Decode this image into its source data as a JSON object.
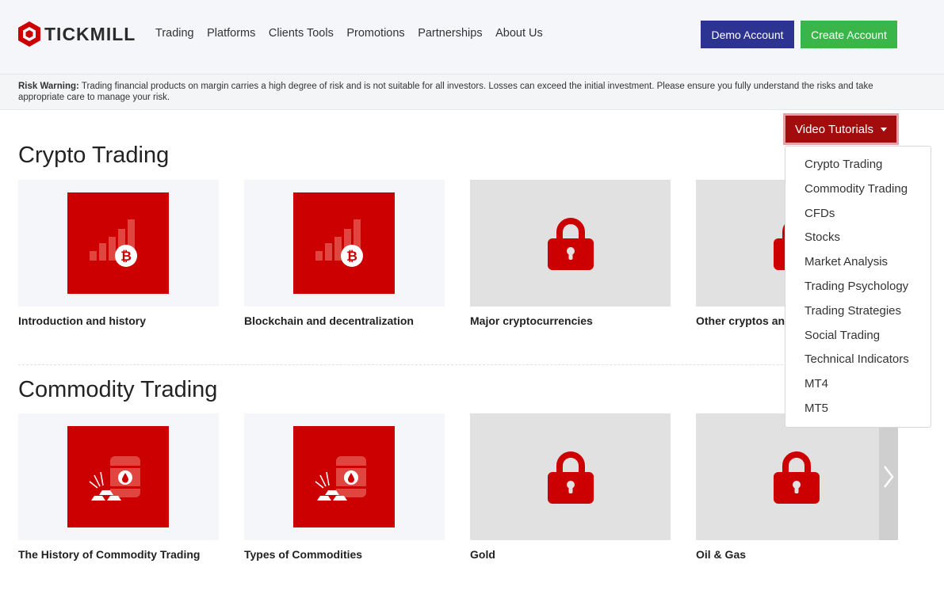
{
  "header": {
    "brand": "TICKMILL",
    "nav": [
      "Trading",
      "Platforms",
      "Clients Tools",
      "Promotions",
      "Partnerships",
      "About Us"
    ],
    "demo_label": "Demo Account",
    "create_label": "Create Account",
    "demo_color": "#2d3390",
    "create_color": "#3ab54a"
  },
  "risk": {
    "label": "Risk Warning:",
    "text": "Trading financial products on margin carries a high degree of risk and is not suitable for all investors. Losses can exceed the initial investment. Please ensure you fully understand the risks and take appropriate care to manage your risk."
  },
  "sections": [
    {
      "title": "Crypto Trading",
      "cards": [
        {
          "title": "Introduction and history",
          "icon": "bitcoin-chart-icon",
          "locked": false
        },
        {
          "title": "Blockchain and decentralization",
          "icon": "bitcoin-chart-icon",
          "locked": false
        },
        {
          "title": "Major cryptocurrencies",
          "icon": "lock-icon",
          "locked": true
        },
        {
          "title": "Other cryptos and",
          "icon": "lock-icon",
          "locked": true
        }
      ]
    },
    {
      "title": "Commodity Trading",
      "cards": [
        {
          "title": "The History of Commodity Trading",
          "icon": "commodities-icon",
          "locked": false
        },
        {
          "title": "Types of Commodities",
          "icon": "commodities-icon",
          "locked": false
        },
        {
          "title": "Gold",
          "icon": "lock-icon",
          "locked": true
        },
        {
          "title": "Oil & Gas",
          "icon": "lock-icon",
          "locked": true
        }
      ]
    }
  ],
  "video_tutorials": {
    "label": "Video Tutorials",
    "items": [
      "Crypto Trading",
      "Commodity Trading",
      "CFDs",
      "Stocks",
      "Market Analysis",
      "Trading Psychology",
      "Trading Strategies",
      "Social Trading",
      "Technical Indicators",
      "MT4",
      "MT5"
    ],
    "color": "#a30c0c"
  },
  "colors": {
    "brand_red": "#cc0000",
    "locked_bg": "#e1e1e1"
  }
}
